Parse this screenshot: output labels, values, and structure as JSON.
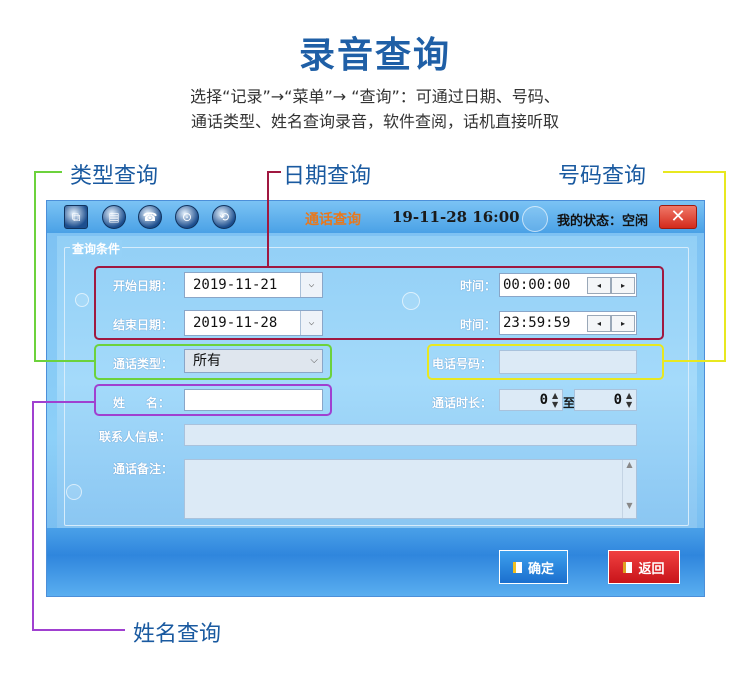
{
  "header": {
    "title": "录音查询",
    "desc_line1": "选择“记录”→“菜单”→ “查询”：可通过日期、号码、",
    "desc_line2": "通话类型、姓名查询录音，软件查阅，话机直接听取"
  },
  "annotations": {
    "type_query": "类型查询",
    "date_query": "日期查询",
    "number_query": "号码查询",
    "name_query": "姓名查询"
  },
  "colors": {
    "annotation_text": "#1a5aa0",
    "box_date": "#a01840",
    "box_number": "#e8e820",
    "box_type": "#6cd23c",
    "box_name": "#a040d0",
    "line_type": "#6cd23c",
    "line_date": "#a01840",
    "line_number": "#e8e820",
    "line_name": "#a040d0"
  },
  "window": {
    "title": "通话查询",
    "datetime": "19-11-28  16:00",
    "status_label": "我的状态：空闲",
    "close_glyph": "✕",
    "toolbar_icons": [
      "users-icon",
      "record-icon",
      "phone-icon",
      "search-icon",
      "refresh-icon"
    ]
  },
  "form": {
    "group_title": "查询条件",
    "start_date_label": "开始日期：",
    "start_date_value": "2019-11-21",
    "start_time_label": "时间：",
    "start_time_value": "00:00:00",
    "end_date_label": "结束日期：",
    "end_date_value": "2019-11-28",
    "end_time_label": "时间：",
    "end_time_value": "23:59:59",
    "call_type_label": "通话类型：",
    "call_type_value": "所有",
    "phone_label": "电话号码：",
    "phone_value": "",
    "name_label": "姓     名：",
    "name_value": "",
    "duration_label": "通话时长：",
    "duration_from": "0",
    "duration_to_label": "至",
    "duration_to": "0",
    "contact_label": "联系人信息：",
    "contact_value": "",
    "note_label": "通话备注：",
    "note_value": ""
  },
  "buttons": {
    "confirm": "确定",
    "back": "返回"
  }
}
